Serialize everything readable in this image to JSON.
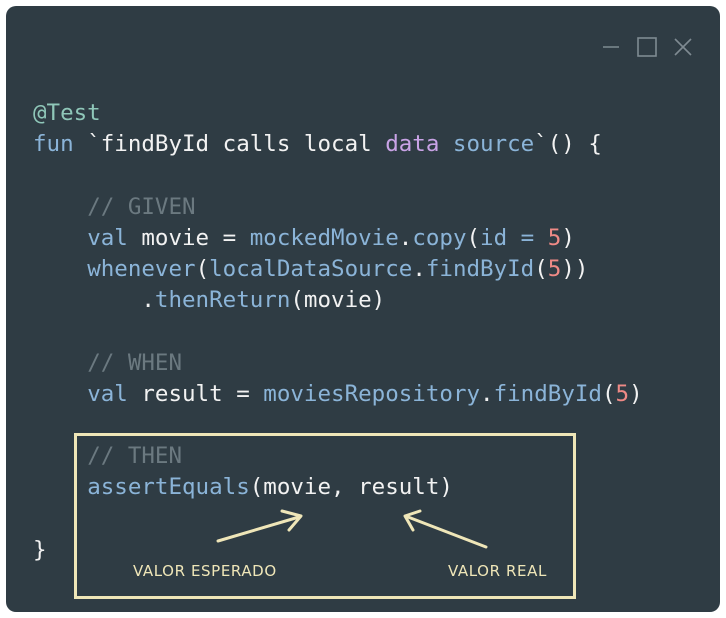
{
  "window": {
    "controls": {
      "minimize": "minimize-icon",
      "maximize": "maximize-icon",
      "close": "close-icon"
    }
  },
  "code": {
    "l1_annotation": "@Test",
    "l2_kw": "fun",
    "l2_name_a": "`findById calls local ",
    "l2_name_b": "data",
    "l2_name_c": " source",
    "l2_name_d": "`",
    "l2_rest": "() {",
    "l4_comment": "// GIVEN",
    "l5_kw": "val",
    "l5_var": " movie = ",
    "l5_call": "mockedMovie",
    "l5_dot": ".",
    "l5_method": "copy",
    "l5_paren": "(",
    "l5_arg": "id = ",
    "l5_num": "5",
    "l5_close": ")",
    "l6_fn": "whenever",
    "l6_open": "(",
    "l6_obj": "localDataSource",
    "l6_dot": ".",
    "l6_method": "findById",
    "l6_paren": "(",
    "l6_num": "5",
    "l6_close": "))",
    "l7_dot": ".",
    "l7_method": "thenReturn",
    "l7_rest": "(movie)",
    "l9_comment": "// WHEN",
    "l10_kw": "val",
    "l10_var": " result = ",
    "l10_obj": "moviesRepository",
    "l10_dot": ".",
    "l10_method": "findById",
    "l10_paren": "(",
    "l10_num": "5",
    "l10_close": ")",
    "l12_comment": "// THEN",
    "l13_fn": "assertEquals",
    "l13_args": "(movie, result)",
    "l15_brace": "}"
  },
  "annotations": {
    "expected_label": "VALOR ESPERADO",
    "actual_label": "VALOR REAL"
  },
  "colors": {
    "background": "#2f3c44",
    "highlight": "#efe6b8",
    "keyword": "#8bb4d8",
    "annotation": "#8fc7b9",
    "number": "#ef8a86",
    "comment": "#6b7980"
  }
}
